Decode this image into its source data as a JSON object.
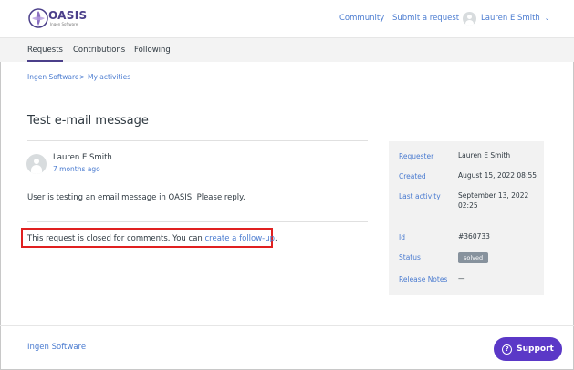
{
  "header": {
    "logo_text": "OASIS",
    "logo_subtext": "Ingen Software",
    "links": [
      "Community",
      "Submit a request"
    ],
    "user_name": "Lauren E Smith"
  },
  "subnav": {
    "tabs": [
      "Requests",
      "Contributions",
      "Following"
    ],
    "active_tab": "Requests"
  },
  "breadcrumb": {
    "items": [
      "Ingen Software",
      "My activities"
    ],
    "separator": ">"
  },
  "request": {
    "title": "Test e-mail message",
    "author": "Lauren E Smith",
    "time_ago": "7 months ago",
    "body": "User is testing an email message in OASIS. Please reply.",
    "closed_notice": "This request is closed for comments. You can ",
    "closed_link": "create a follow-up",
    "closed_end": "."
  },
  "details": {
    "requester_label": "Requester",
    "requester_value": "Lauren E Smith",
    "created_label": "Created",
    "created_value": "August 15, 2022 08:55",
    "last_activity_label": "Last activity",
    "last_activity_value_1": "September 13, 2022",
    "last_activity_value_2": "02:25",
    "id_label": "Id",
    "id_value": "#360733",
    "status_label": "Status",
    "status_value": "solved",
    "release_notes_label": "Release Notes",
    "release_notes_value": "—"
  },
  "footer": {
    "link": "Ingen Software",
    "support_label": "Support"
  },
  "colors": {
    "brand": "#4b3f8a",
    "link": "#4a7bd0",
    "support_button": "#5b38c7",
    "highlight_box": "#e02020"
  }
}
